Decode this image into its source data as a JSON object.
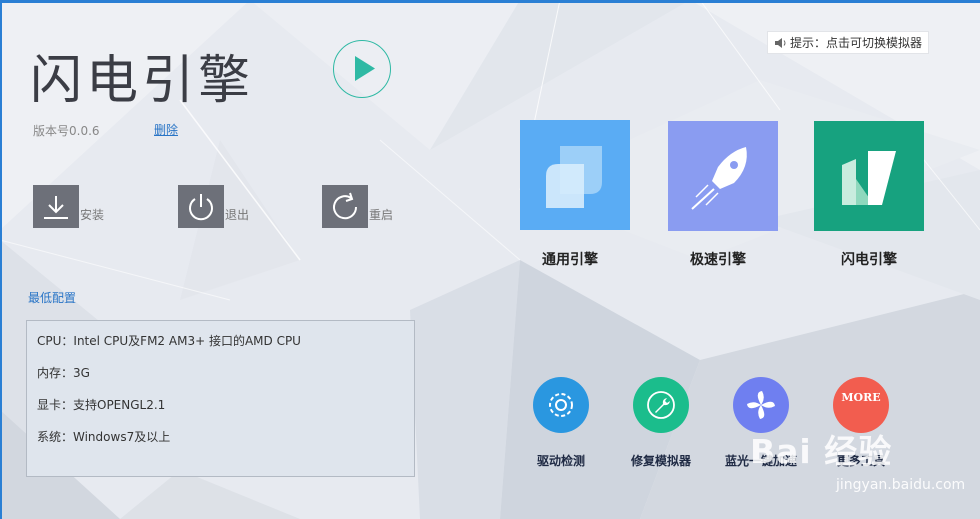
{
  "app": {
    "title": "闪电引擎",
    "version": "版本号0.0.6",
    "delete_label": "删除"
  },
  "actions": {
    "install": "安装",
    "exit": "退出",
    "restart": "重启"
  },
  "min_config": {
    "title": "最低配置",
    "cpu": "CPU：Intel CPU及FM2  AM3+ 接口的AMD CPU",
    "memory": "内存：3G",
    "gpu": "显卡：支持OPENGL2.1",
    "os": "系统：Windows7及以上"
  },
  "hint": {
    "text": "提示：点击可切换模拟器"
  },
  "engines": [
    {
      "label": "通用引擎",
      "color": "#5aacf4"
    },
    {
      "label": "极速引擎",
      "color": "#8a9cf1"
    },
    {
      "label": "闪电引擎",
      "color": "#17a27f"
    }
  ],
  "tools": [
    {
      "label": "驱动检测",
      "color": "#2a97e0"
    },
    {
      "label": "修复模拟器",
      "color": "#1bbd8c"
    },
    {
      "label": "蓝光一键加速",
      "color": "#6f7ff0"
    },
    {
      "label": "更多工具",
      "color": "#f25d4f",
      "icon_text": "MORE"
    }
  ],
  "watermark": {
    "brand": "Bai 经验",
    "url": "jingyan.baidu.com"
  },
  "colors": {
    "accent_blue": "#2874c6",
    "play_teal": "#2fb9a4"
  }
}
